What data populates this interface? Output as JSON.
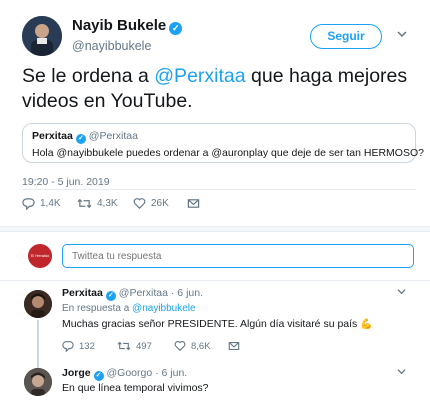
{
  "tweet": {
    "author_name": "Nayib Bukele",
    "author_handle": "@nayibbukele",
    "follow_label": "Seguir",
    "text_before": "Se le ordena a ",
    "text_mention": "@Perxitaa",
    "text_after": " que haga mejores videos en YouTube.",
    "timestamp": "19:20 - 5 jun. 2019",
    "replies": "1,4K",
    "retweets": "4,3K",
    "likes": "26K"
  },
  "quote": {
    "name": "Perxitaa",
    "handle": "@Perxitaa",
    "text": "Hola @nayibbukele puedes ordenar a @auronplay que deje de ser tan HERMOSO?"
  },
  "composer": {
    "placeholder": "Twittea tu respuesta",
    "avatar_text": "El Heraldo"
  },
  "replies": [
    {
      "name": "Perxitaa",
      "handle_date": "@Perxitaa · 6 jun.",
      "in_reply_prefix": "En respuesta a ",
      "in_reply_mention": "@nayibbukele",
      "text": "Muchas gracias señor PRESIDENTE. Algún día visitaré su país",
      "emoji": "💪",
      "replies": "132",
      "retweets": "497",
      "likes": "8,6K"
    },
    {
      "name": "Jorge",
      "handle_date": "@Goorgo · 6 jun.",
      "text": "En que línea temporal vivimos?"
    }
  ],
  "icons": {
    "verified": "verified-badge-icon",
    "reply": "reply-icon",
    "retweet": "retweet-icon",
    "like": "heart-icon",
    "message": "direct-message-icon",
    "caret": "chevron-down-icon"
  },
  "colors": {
    "accent": "#1da1f2",
    "muted": "#657786",
    "text": "#14171a"
  }
}
